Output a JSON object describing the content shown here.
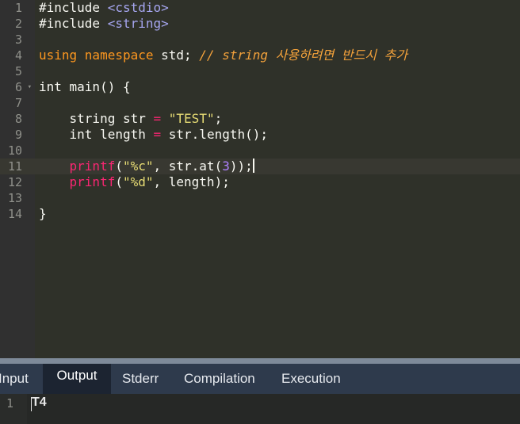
{
  "editor": {
    "lines": [
      {
        "num": "1",
        "segments": [
          {
            "t": "#include ",
            "c": "pp"
          },
          {
            "t": "<cstdio>",
            "c": "hdr"
          }
        ]
      },
      {
        "num": "2",
        "segments": [
          {
            "t": "#include ",
            "c": "pp"
          },
          {
            "t": "<string>",
            "c": "hdr"
          }
        ]
      },
      {
        "num": "3",
        "segments": []
      },
      {
        "num": "4",
        "segments": [
          {
            "t": "using ",
            "c": "ns"
          },
          {
            "t": "namespace ",
            "c": "ns"
          },
          {
            "t": "std; ",
            "c": ""
          },
          {
            "t": "// string 사용하려면 반드시 추가",
            "c": "cm"
          }
        ]
      },
      {
        "num": "5",
        "segments": []
      },
      {
        "num": "6",
        "fold": "▾",
        "segments": [
          {
            "t": "int ",
            "c": ""
          },
          {
            "t": "main() {",
            "c": ""
          }
        ]
      },
      {
        "num": "7",
        "segments": []
      },
      {
        "num": "8",
        "segments": [
          {
            "t": "    string str ",
            "c": ""
          },
          {
            "t": "=",
            "c": "op"
          },
          {
            "t": " ",
            "c": ""
          },
          {
            "t": "\"TEST\"",
            "c": "st"
          },
          {
            "t": ";",
            "c": ""
          }
        ]
      },
      {
        "num": "9",
        "segments": [
          {
            "t": "    int length ",
            "c": ""
          },
          {
            "t": "=",
            "c": "op"
          },
          {
            "t": " str.length();",
            "c": ""
          }
        ]
      },
      {
        "num": "10",
        "segments": []
      },
      {
        "num": "11",
        "active": true,
        "segments": [
          {
            "t": "    ",
            "c": ""
          },
          {
            "t": "printf",
            "c": "fn"
          },
          {
            "t": "(",
            "c": ""
          },
          {
            "t": "\"%c\"",
            "c": "st"
          },
          {
            "t": ", str.at(",
            "c": ""
          },
          {
            "t": "3",
            "c": "nm"
          },
          {
            "t": "));",
            "c": ""
          }
        ],
        "cursor": true
      },
      {
        "num": "12",
        "segments": [
          {
            "t": "    ",
            "c": ""
          },
          {
            "t": "printf",
            "c": "fn"
          },
          {
            "t": "(",
            "c": ""
          },
          {
            "t": "\"%d\"",
            "c": "st"
          },
          {
            "t": ", length);",
            "c": ""
          }
        ]
      },
      {
        "num": "13",
        "segments": []
      },
      {
        "num": "14",
        "segments": [
          {
            "t": "}",
            "c": ""
          }
        ]
      }
    ]
  },
  "tabs": [
    {
      "label": "Input",
      "active": false
    },
    {
      "label": "Output",
      "active": true
    },
    {
      "label": "Stderr",
      "active": false
    },
    {
      "label": "Compilation",
      "active": false
    },
    {
      "label": "Execution",
      "active": false
    }
  ],
  "output": {
    "line_number": "1",
    "text": "T4"
  },
  "colors": {
    "editor_bg": "#2f3129",
    "tab_bar_bg": "#2e3a4c",
    "tab_active_bg": "#1c2431"
  }
}
